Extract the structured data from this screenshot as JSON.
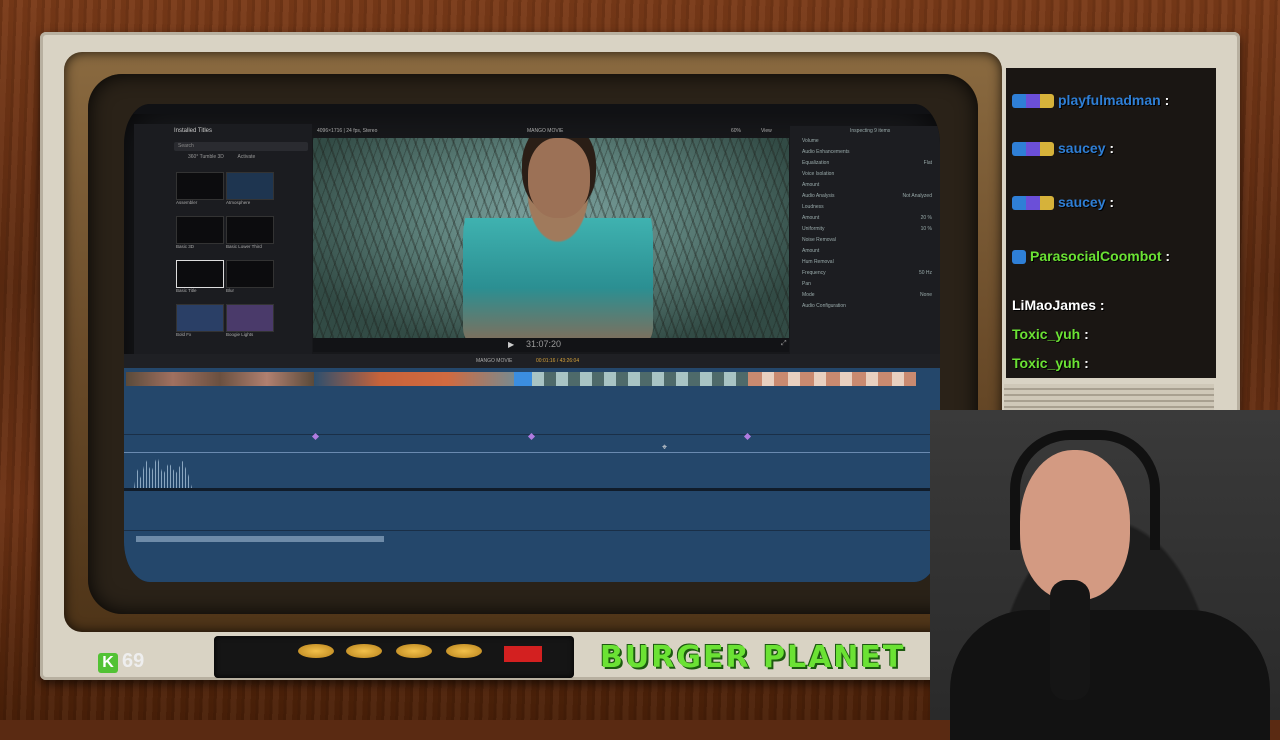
{
  "fcp": {
    "browser_title": "Installed Titles",
    "search_placeholder": "Search",
    "category_1": "360° Tumble 3D",
    "category_2": "Activate",
    "titles": [
      {
        "label": "Assembler"
      },
      {
        "label": "Atmosphere"
      },
      {
        "label": "Basic 3D"
      },
      {
        "label": "Basic Lower Third"
      },
      {
        "label": "Basic Title"
      },
      {
        "label": "Blur"
      },
      {
        "label": "Bold Fx"
      },
      {
        "label": "Boogie Lights"
      }
    ],
    "viewer_format": "4096×1716 | 24 fps, Stereo",
    "project_name": "MANGO MOVIE",
    "zoom": "60%",
    "view_label": "View",
    "timecode": "31:07:20",
    "timeline_project": "MANGO MOVIE",
    "timeline_duration": "00:01:16 / 43:26:04",
    "inspector_status": "Inspecting 9 items",
    "inspector_rows": [
      {
        "label": "Volume",
        "value": ""
      },
      {
        "label": "Audio Enhancements",
        "value": ""
      },
      {
        "label": "Equalization",
        "value": "Flat"
      },
      {
        "label": "Voice Isolation",
        "value": ""
      },
      {
        "label": "Amount",
        "value": ""
      },
      {
        "label": "Audio Analysis",
        "value": "Not Analyzed"
      },
      {
        "label": "Loudness",
        "value": ""
      },
      {
        "label": "Amount",
        "value": "20 %"
      },
      {
        "label": "Uniformity",
        "value": "10 %"
      },
      {
        "label": "Noise Removal",
        "value": ""
      },
      {
        "label": "Amount",
        "value": ""
      },
      {
        "label": "Hum Removal",
        "value": ""
      },
      {
        "label": "Frequency",
        "value": "50 Hz"
      },
      {
        "label": "Pan",
        "value": ""
      },
      {
        "label": "Mode",
        "value": "None"
      },
      {
        "label": "Audio Configuration",
        "value": ""
      }
    ]
  },
  "chat": {
    "messages": [
      {
        "user": "playfulmadman",
        "sep": " :",
        "color": "#2f7fd6"
      },
      {
        "user": "saucey",
        "sep": " :",
        "color": "#2f7fd6"
      },
      {
        "user": "saucey",
        "sep": " :",
        "color": "#2f7fd6"
      },
      {
        "user": "ParasocialCoombot",
        "sep": " :",
        "color": "#6be234"
      },
      {
        "user": "LiMaoJames",
        "sep": " :",
        "color": "#ffffff"
      },
      {
        "user": "Toxic_yuh",
        "sep": " :",
        "color": "#6be234"
      },
      {
        "user": "Toxic_yuh",
        "sep": " :",
        "color": "#6be234"
      }
    ]
  },
  "overlay": {
    "k_letter": "K",
    "counter_value": "69",
    "brand_title": "BURGER PLANET"
  },
  "colors": {
    "timeline_blue": "#24476b",
    "brand_green": "#6be234",
    "wood_brown": "#5c2a10"
  }
}
